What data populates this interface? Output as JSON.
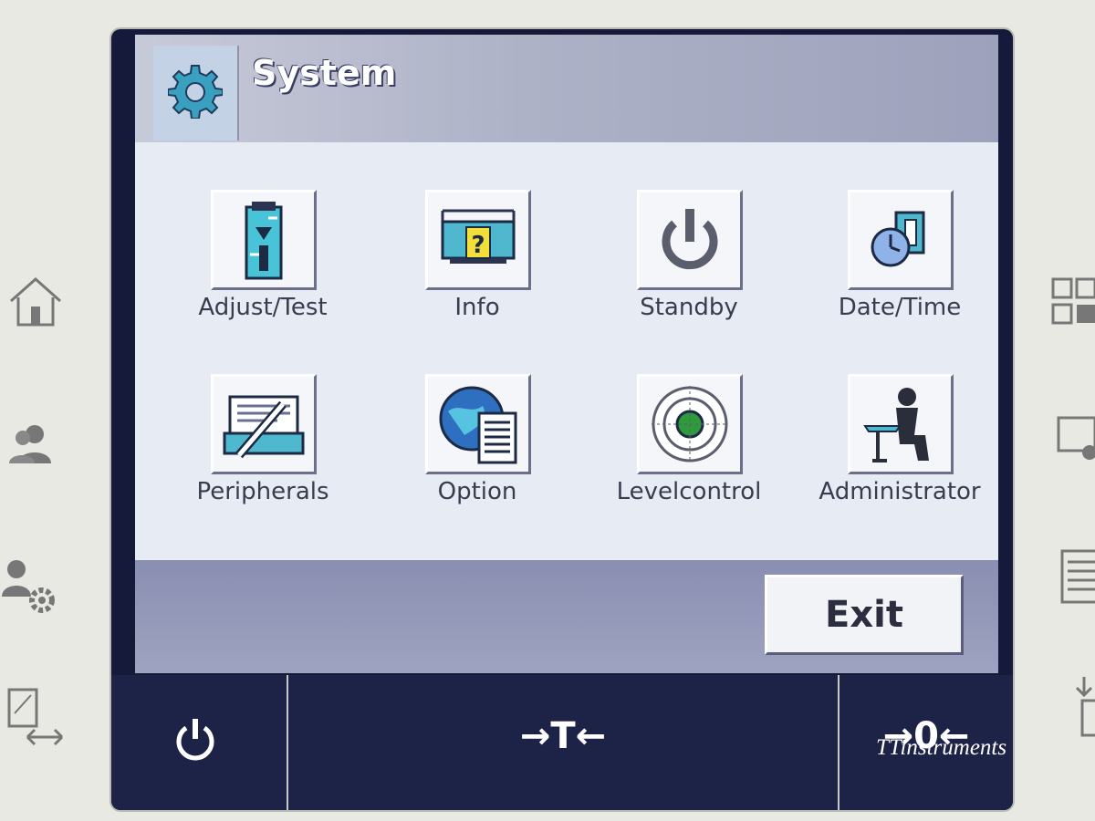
{
  "header": {
    "title": "System",
    "icon": "gear-icon"
  },
  "menu": {
    "items": [
      {
        "label": "Adjust/Test",
        "icon": "weight-adjust-icon"
      },
      {
        "label": "Info",
        "icon": "info-scale-icon"
      },
      {
        "label": "Standby",
        "icon": "power-icon"
      },
      {
        "label": "Date/Time",
        "icon": "calendar-clock-icon"
      },
      {
        "label": "Peripherals",
        "icon": "printer-icon"
      },
      {
        "label": "Option",
        "icon": "globe-document-icon"
      },
      {
        "label": "Levelcontrol",
        "icon": "level-bubble-icon"
      },
      {
        "label": "Administrator",
        "icon": "administrator-icon"
      }
    ]
  },
  "actions": {
    "exit_label": "Exit"
  },
  "softkeys": {
    "power_icon": "power-icon",
    "tare_label": "→T←",
    "zero_label": "→0←"
  },
  "watermark": "TTinstruments",
  "colors": {
    "accent": "#1d2247",
    "menu_bg": "#e7ebf4",
    "title_bar": "#aeb2c7"
  }
}
